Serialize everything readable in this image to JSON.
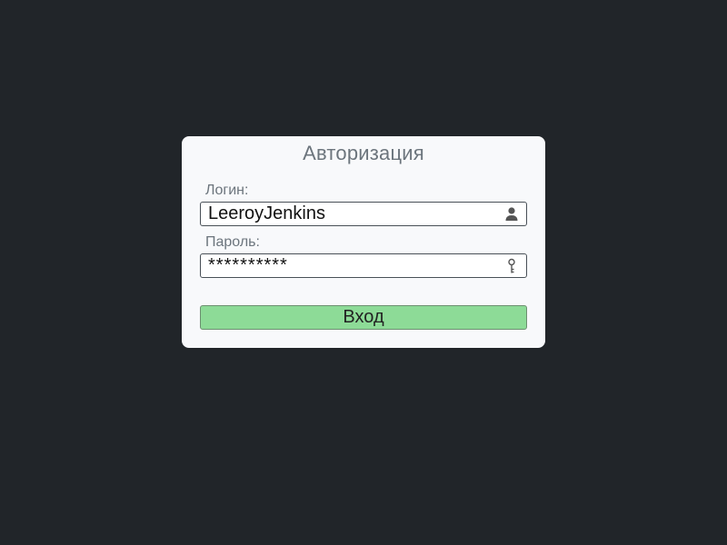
{
  "form": {
    "title": "Авторизация",
    "login": {
      "label": "Логин:",
      "value": "LeeroyJenkins",
      "icon": "user-icon"
    },
    "password": {
      "label": "Пароль:",
      "value": "**********",
      "icon": "key-icon"
    },
    "submit_label": "Вход"
  },
  "colors": {
    "background": "#212529",
    "card": "#f8f9fb",
    "button": "#8ddb97",
    "label_text": "#6c757d"
  }
}
